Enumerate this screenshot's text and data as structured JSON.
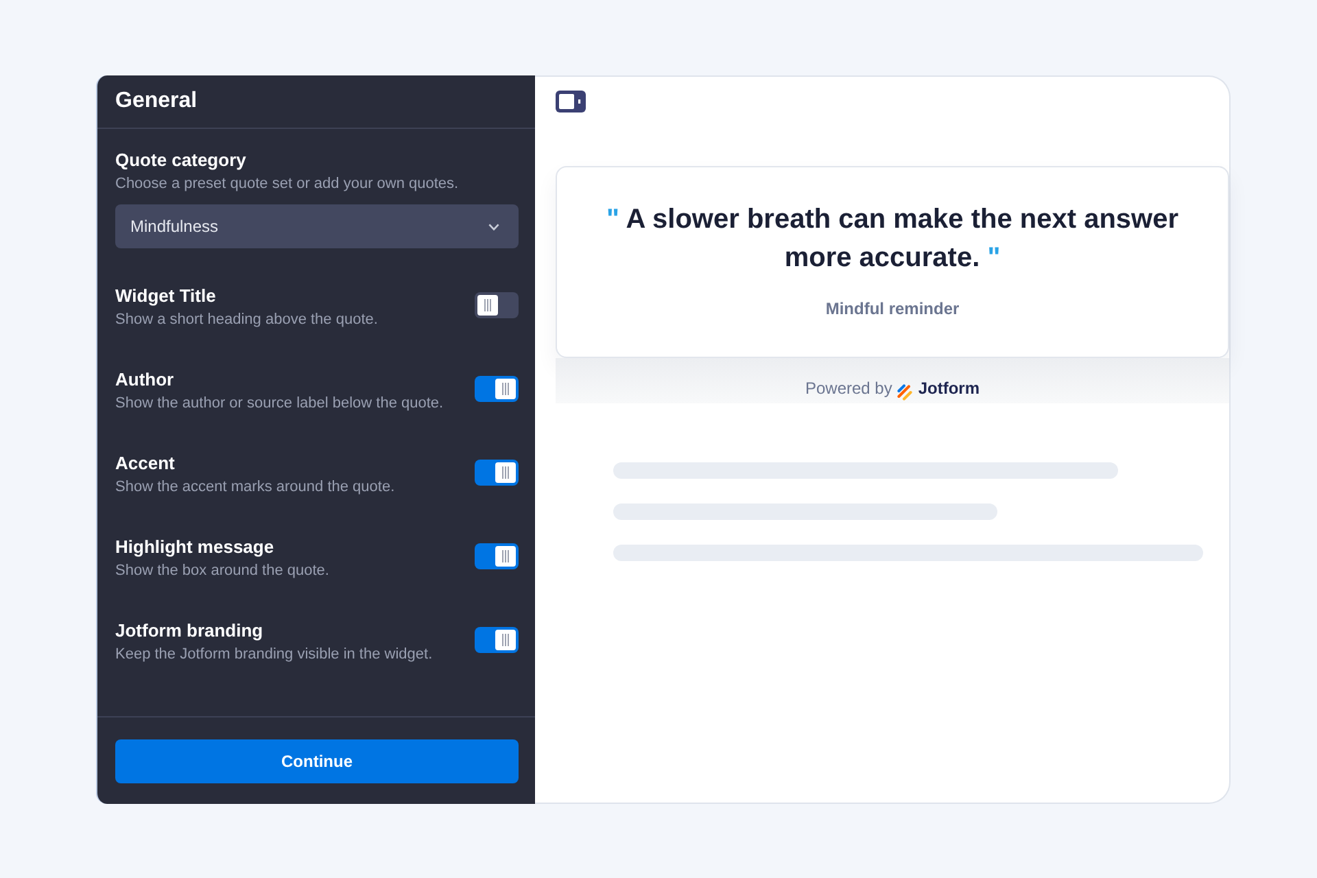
{
  "sidebar": {
    "title": "General",
    "quote_category": {
      "label": "Quote category",
      "description": "Choose a preset quote set or add your own quotes.",
      "value": "Mindfulness"
    },
    "settings": [
      {
        "label": "Widget Title",
        "description": "Show a short heading above the quote.",
        "on": false
      },
      {
        "label": "Author",
        "description": "Show the author or source label below the quote.",
        "on": true
      },
      {
        "label": "Accent",
        "description": "Show the accent marks around the quote.",
        "on": true
      },
      {
        "label": "Highlight message",
        "description": "Show the box around the quote.",
        "on": true
      },
      {
        "label": "Jotform branding",
        "description": "Keep the Jotform branding visible in the widget.",
        "on": true
      }
    ],
    "continue_button": "Continue"
  },
  "preview": {
    "open_mark": "\"",
    "quote": "A slower breath can make the next answer more accurate.",
    "close_mark": "\"",
    "author": "Mindful reminder",
    "powered_by": "Powered by",
    "brand": "Jotform"
  }
}
